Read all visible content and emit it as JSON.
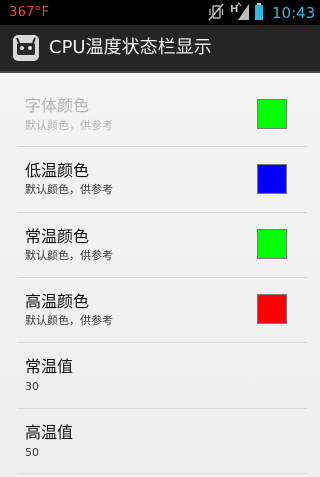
{
  "status_bar": {
    "temperature": "367°F",
    "time": "10:43",
    "icons": [
      "mute-vibrate-icon",
      "hspa-signal-icon",
      "battery-icon"
    ],
    "signal_label": "H",
    "colors": {
      "temperature": "#e5474b",
      "time": "#33b5e5"
    }
  },
  "action_bar": {
    "title": "CPU温度状态栏显示",
    "icon": "app-robot-icon"
  },
  "preferences": [
    {
      "title": "字体颜色",
      "summary": "默认颜色，供参考",
      "color": "#00ff00",
      "enabled": false
    },
    {
      "title": "低温颜色",
      "summary": "默认颜色，供参考",
      "color": "#0000ff",
      "enabled": true
    },
    {
      "title": "常温颜色",
      "summary": "默认颜色，供参考",
      "color": "#00ff00",
      "enabled": true
    },
    {
      "title": "高温颜色",
      "summary": "默认颜色，供参考",
      "color": "#ff0000",
      "enabled": true
    },
    {
      "title": "常温值",
      "summary": "30",
      "enabled": true
    },
    {
      "title": "高温值",
      "summary": "50",
      "enabled": true
    }
  ]
}
